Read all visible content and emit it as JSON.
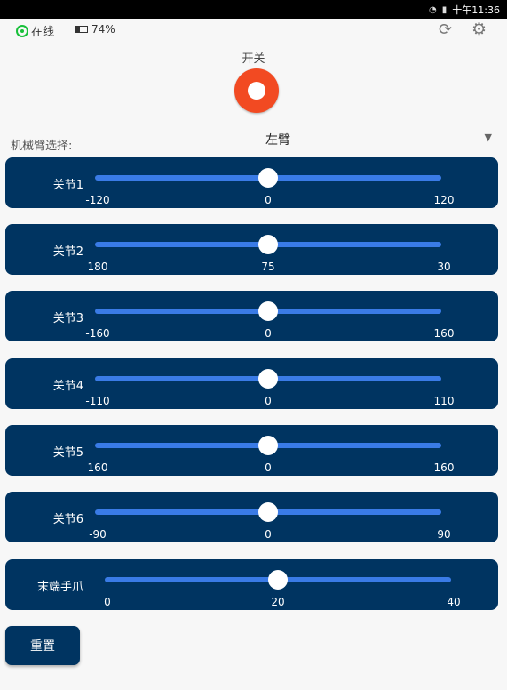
{
  "status_bar": {
    "time": "11:36",
    "time_prefix": "十午"
  },
  "header": {
    "online_label": "在线",
    "battery_label": "74%",
    "refresh_icon": "refresh-icon",
    "settings_icon": "gear-icon"
  },
  "power": {
    "label": "开关",
    "state_color": "#f24a22"
  },
  "arm_select": {
    "label": "机械臂选择:",
    "value": "左臂"
  },
  "joints": [
    {
      "label": "关节1",
      "min": "-120",
      "mid": "0",
      "max": "120",
      "value": 0.5
    },
    {
      "label": "关节2",
      "min": "180",
      "mid": "75",
      "max": "30",
      "value": 0.5
    },
    {
      "label": "关节3",
      "min": "-160",
      "mid": "0",
      "max": "160",
      "value": 0.5
    },
    {
      "label": "关节4",
      "min": "-110",
      "mid": "0",
      "max": "110",
      "value": 0.5
    },
    {
      "label": "关节5",
      "min": "160",
      "mid": "0",
      "max": "160",
      "value": 0.5
    },
    {
      "label": "关节6",
      "min": "-90",
      "mid": "0",
      "max": "90",
      "value": 0.5
    },
    {
      "label": "末端手爪",
      "min": "0",
      "mid": "20",
      "max": "40",
      "value": 0.5
    }
  ],
  "reset_label": "重置",
  "colors": {
    "panel": "#003461",
    "track": "#3a7be6",
    "online": "#18c03a"
  }
}
